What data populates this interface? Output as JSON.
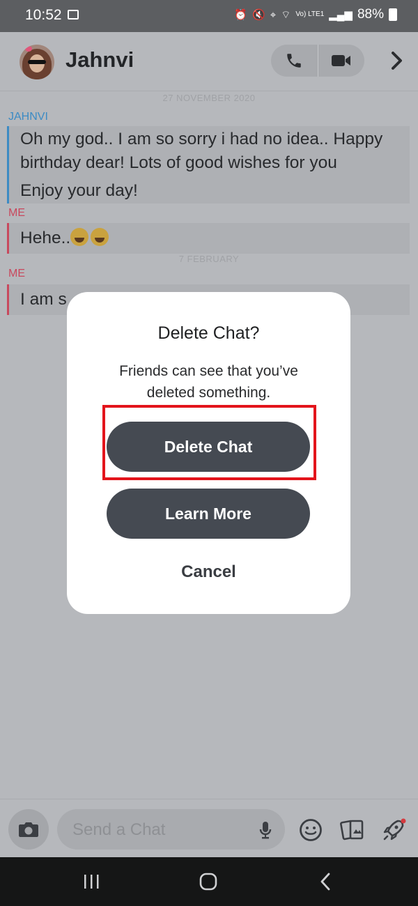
{
  "status_bar": {
    "time": "10:52",
    "battery": "88%",
    "signal_label": "Vo) LTE1"
  },
  "header": {
    "contact_name": "Jahnvi"
  },
  "chat": {
    "date_1": "27 NOVEMBER 2020",
    "messages": [
      {
        "sender": "JAHNVI",
        "lines": [
          "Oh my god.. I am so sorry i had no idea.. Happy birthday dear!  Lots of good wishes for you",
          "Enjoy your day!"
        ]
      },
      {
        "sender": "ME",
        "text": "Hehe.."
      },
      {
        "sender": "ME",
        "text": "I am s"
      }
    ],
    "date_2": "7 FEBRUARY"
  },
  "dialog": {
    "title": "Delete Chat?",
    "description": "Friends can see that you’ve deleted something.",
    "delete_label": "Delete Chat",
    "learn_more_label": "Learn More",
    "cancel_label": "Cancel"
  },
  "composer": {
    "placeholder": "Send a Chat"
  },
  "colors": {
    "accent_blue": "#3c8bc4",
    "accent_red": "#c8485d",
    "button_dark": "#454a52",
    "highlight_red": "#e3141b"
  }
}
